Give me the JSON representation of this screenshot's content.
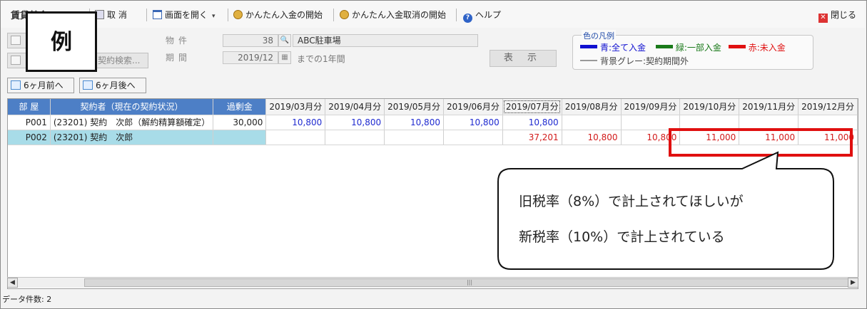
{
  "toolbar": {
    "title": "賃貸基金10",
    "cancel_label": "取 消",
    "open_screen_label": "画面を開く",
    "start_easy_payment_label": "かんたん入金の開始",
    "start_easy_payment_cancel_label": "かんたん入金取消の開始",
    "help_label": "ヘルプ",
    "close_label": "閉じる"
  },
  "badge": {
    "text": "例"
  },
  "contract_search_label": "契約検索...",
  "filters": {
    "property_label": "物件",
    "property_code": "38",
    "property_name": "ABC駐車場",
    "period_label": "期間",
    "period_value": "2019/12",
    "period_suffix": "までの1年間",
    "display_button": "表 示"
  },
  "legend": {
    "title": "色の凡例",
    "blue": "青:全て入金",
    "green": "緑:一部入金",
    "red": "赤:未入金",
    "gray": "背景グレー:契約期間外",
    "colors": {
      "blue": "#1010d0",
      "green": "#1a7a1a",
      "red": "#e01010"
    }
  },
  "nav": {
    "prev": "6ヶ月前へ",
    "next": "6ヶ月後へ"
  },
  "grid": {
    "headers": {
      "room": "部 屋",
      "contractor": "契約者（現在の契約状況）",
      "overpayment": "過剰金",
      "months": [
        "2019/03月分",
        "2019/04月分",
        "2019/05月分",
        "2019/06月分",
        "2019/07月分",
        "2019/08月分",
        "2019/09月分",
        "2019/10月分",
        "2019/11月分",
        "2019/12月分"
      ]
    },
    "rows": [
      {
        "room": "P001",
        "contractor": "(23201) 契約　次郎（解約精算額確定）",
        "overpayment": "30,000",
        "values": [
          "10,800",
          "10,800",
          "10,800",
          "10,800",
          "10,800",
          "",
          "",
          "",
          "",
          ""
        ]
      },
      {
        "room": "P002",
        "contractor": "(23201) 契約　次郎",
        "overpayment": "",
        "values": [
          "",
          "",
          "",
          "",
          "37,201",
          "10,800",
          "10,800",
          "11,000",
          "11,000",
          "11,000"
        ]
      }
    ]
  },
  "status": {
    "record_count": "データ件数: 2"
  },
  "callout": {
    "line1": "旧税率（8%）で計上されてほしいが",
    "line2": "新税率（10%）で計上されている"
  }
}
